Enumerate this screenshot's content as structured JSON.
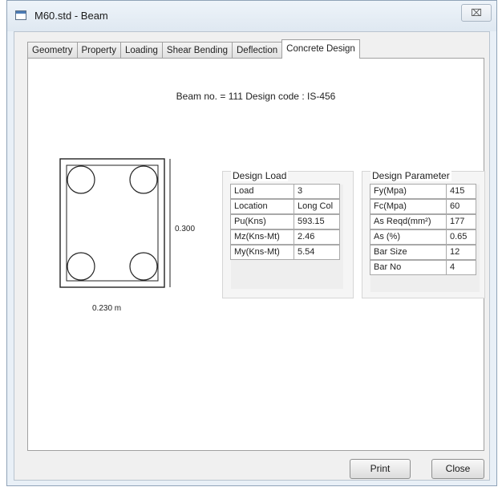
{
  "window": {
    "title": "M60.std - Beam",
    "close_glyph": "⌧"
  },
  "tabs": [
    {
      "label": "Geometry",
      "active": false
    },
    {
      "label": "Property",
      "active": false
    },
    {
      "label": "Loading",
      "active": false
    },
    {
      "label": "Shear Bending",
      "active": false
    },
    {
      "label": "Deflection",
      "active": false
    },
    {
      "label": "Concrete Design",
      "active": true
    }
  ],
  "beam_info": "Beam no. = 111  Design code :  IS-456",
  "section": {
    "depth_label": "0.300",
    "width_label": "0.230 m",
    "bar_count": 4
  },
  "design_load": {
    "title": "Design Load",
    "rows": [
      {
        "label": "Load",
        "value": "3"
      },
      {
        "label": "Location",
        "value": "Long Col"
      },
      {
        "label": "Pu(Kns)",
        "value": "593.15"
      },
      {
        "label": "Mz(Kns-Mt)",
        "value": "2.46"
      },
      {
        "label": "My(Kns-Mt)",
        "value": "5.54"
      }
    ]
  },
  "design_parameter": {
    "title": "Design Parameter",
    "rows": [
      {
        "label": "Fy(Mpa)",
        "value": "415"
      },
      {
        "label": "Fc(Mpa)",
        "value": "60"
      },
      {
        "label": "As Reqd(mm²)",
        "value": "177"
      },
      {
        "label": "As (%)",
        "value": "0.65"
      },
      {
        "label": "Bar Size",
        "value": "12"
      },
      {
        "label": "Bar No",
        "value": "4"
      }
    ]
  },
  "buttons": {
    "print": "Print",
    "close": "Close"
  }
}
